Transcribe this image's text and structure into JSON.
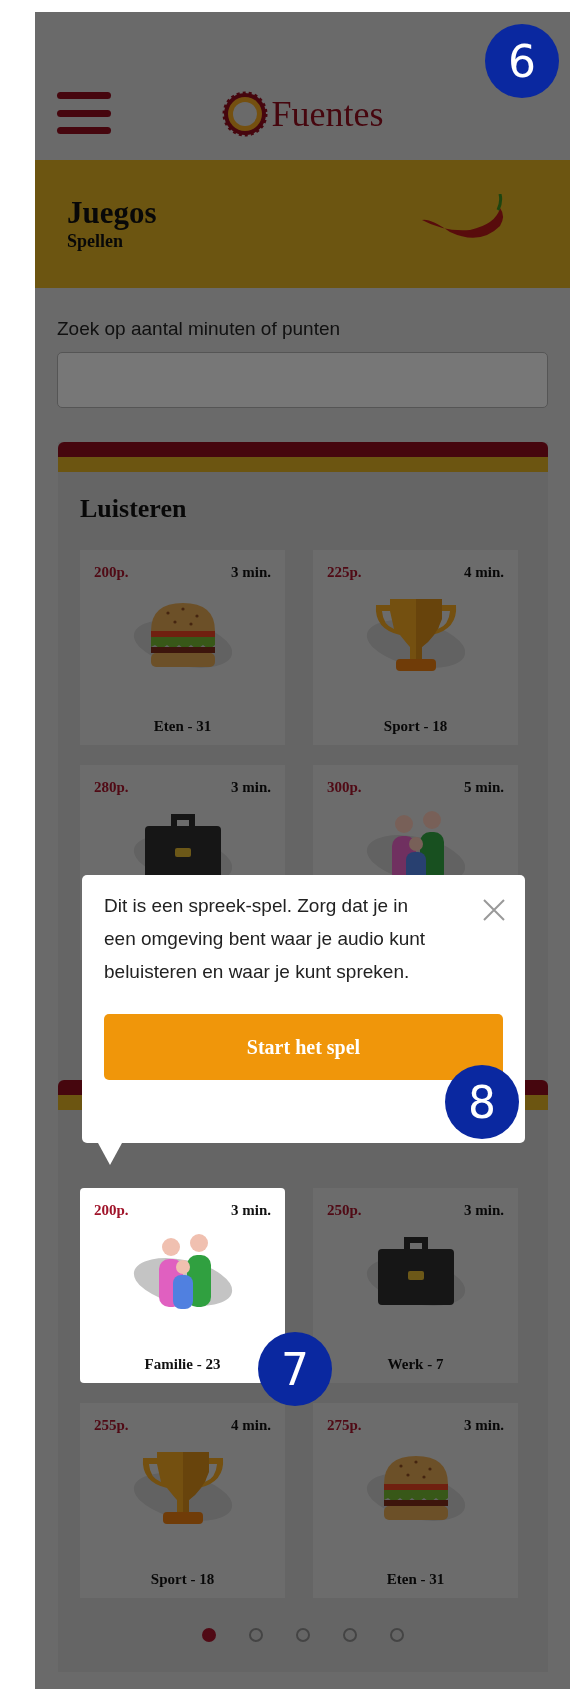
{
  "header": {
    "logo": "Fuentes"
  },
  "banner": {
    "title": "Juegos",
    "subtitle": "Spellen"
  },
  "search": {
    "label": "Zoek op aantal minuten of punten"
  },
  "sections": [
    {
      "title": "Luisteren",
      "tiles": [
        {
          "points": "200p.",
          "minutes": "3 min.",
          "kind": "burger",
          "label": "Eten - 31",
          "highlighted": false
        },
        {
          "points": "225p.",
          "minutes": "4 min.",
          "kind": "trophy",
          "label": "Sport - 18",
          "highlighted": false
        },
        {
          "points": "280p.",
          "minutes": "3 min.",
          "kind": "briefcase",
          "highlighted": false
        },
        {
          "points": "300p.",
          "minutes": "5 min.",
          "kind": "family",
          "highlighted": false
        }
      ]
    },
    {
      "tiles": [
        {
          "points": "200p.",
          "minutes": "3 min.",
          "kind": "family",
          "label": "Familie - 23",
          "highlighted": true
        },
        {
          "points": "250p.",
          "minutes": "3 min.",
          "kind": "briefcase",
          "label": "Werk - 7",
          "highlighted": false
        },
        {
          "points": "255p.",
          "minutes": "4 min.",
          "kind": "trophy",
          "label": "Sport - 18",
          "highlighted": false
        },
        {
          "points": "275p.",
          "minutes": "3 min.",
          "kind": "burger",
          "label": "Eten - 31",
          "highlighted": false
        }
      ],
      "pager": [
        {
          "selected": true
        },
        {
          "selected": false
        },
        {
          "selected": false
        },
        {
          "selected": false
        },
        {
          "selected": false
        }
      ]
    }
  ],
  "tooltip": {
    "text": "Dit is een spreek-spel. Zorg dat je in een omgeving bent waar je audio kunt beluisteren en waar je kunt spreken.",
    "button": "Start het spel"
  },
  "badges": [
    {
      "label": "6"
    },
    {
      "label": "7"
    },
    {
      "label": "8"
    }
  ]
}
